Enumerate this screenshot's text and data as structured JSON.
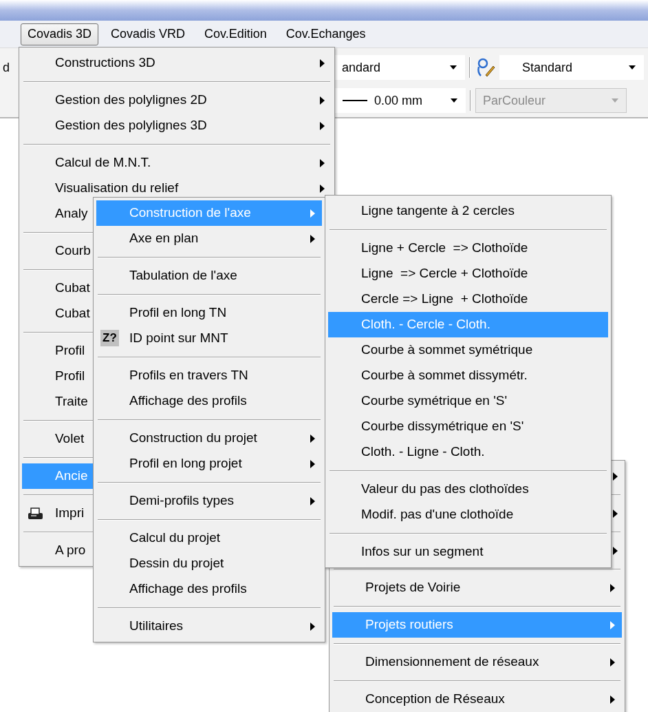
{
  "menubar": [
    {
      "label": "Covadis 3D",
      "selected": true
    },
    {
      "label": "Covadis VRD",
      "selected": false
    },
    {
      "label": "Cov.Edition",
      "selected": false
    },
    {
      "label": "Cov.Echanges",
      "selected": false
    }
  ],
  "toolbar": {
    "row_1": {
      "edge_text": "d",
      "combos": [
        {
          "value": "andard",
          "disabled": false
        },
        {
          "value": "Standard",
          "disabled": false
        }
      ]
    },
    "row_2": {
      "combos": [
        {
          "value": "0.00 mm",
          "disabled": false
        },
        {
          "value": "ParCouleur",
          "disabled": true
        }
      ]
    }
  },
  "menus": [
    {
      "items": [
        {
          "kind": "item",
          "label": "Constructions 3D",
          "submenu": true,
          "selected": false
        },
        {
          "kind": "separator"
        },
        {
          "kind": "item",
          "label": "Gestion des polylignes 2D",
          "submenu": true,
          "selected": false
        },
        {
          "kind": "item",
          "label": "Gestion des polylignes 3D",
          "submenu": true,
          "selected": false
        },
        {
          "kind": "separator"
        },
        {
          "kind": "item",
          "label": "Calcul de M.N.T.",
          "submenu": true,
          "selected": false
        },
        {
          "kind": "item",
          "label": "Visualisation du relief",
          "submenu": true,
          "selected": false
        },
        {
          "kind": "partial",
          "label": "Analy",
          "submenu": false,
          "selected": false
        },
        {
          "kind": "separator"
        },
        {
          "kind": "partial",
          "label": "Courb",
          "submenu": false,
          "selected": false
        },
        {
          "kind": "separator"
        },
        {
          "kind": "partial",
          "label": "Cubat",
          "submenu": false,
          "selected": false
        },
        {
          "kind": "partial",
          "label": "Cubat",
          "submenu": false,
          "selected": false
        },
        {
          "kind": "separator"
        },
        {
          "kind": "partial",
          "label": "Profil",
          "submenu": false,
          "selected": false
        },
        {
          "kind": "partial",
          "label": "Profil",
          "submenu": false,
          "selected": false
        },
        {
          "kind": "partial",
          "label": "Traite",
          "submenu": false,
          "selected": false
        },
        {
          "kind": "separator"
        },
        {
          "kind": "partial",
          "label": "Volet",
          "submenu": false,
          "selected": false
        },
        {
          "kind": "separator"
        },
        {
          "kind": "partial",
          "label": "Ancie",
          "submenu": false,
          "selected": true
        },
        {
          "kind": "separator"
        },
        {
          "kind": "printer",
          "label": "Impri",
          "submenu": false,
          "selected": false
        },
        {
          "kind": "separator"
        },
        {
          "kind": "partial",
          "label": "A pro",
          "submenu": false,
          "selected": false
        }
      ]
    },
    {
      "items": [
        {
          "kind": "item",
          "label": "Construction de l'axe",
          "submenu": true,
          "selected": true
        },
        {
          "kind": "item",
          "label": "Axe en plan",
          "submenu": true,
          "selected": false
        },
        {
          "kind": "separator"
        },
        {
          "kind": "item",
          "label": "Tabulation de l'axe",
          "submenu": false,
          "selected": false
        },
        {
          "kind": "separator"
        },
        {
          "kind": "item",
          "label": "Profil en long TN",
          "submenu": false,
          "selected": false
        },
        {
          "kind": "item",
          "label": "ID point sur MNT",
          "submenu": false,
          "selected": false,
          "badge": "Z?"
        },
        {
          "kind": "separator"
        },
        {
          "kind": "item",
          "label": "Profils en travers TN",
          "submenu": false,
          "selected": false
        },
        {
          "kind": "item",
          "label": "Affichage des profils",
          "submenu": false,
          "selected": false
        },
        {
          "kind": "separator"
        },
        {
          "kind": "item",
          "label": "Construction du projet",
          "submenu": true,
          "selected": false
        },
        {
          "kind": "item",
          "label": "Profil en long projet",
          "submenu": true,
          "selected": false
        },
        {
          "kind": "separator"
        },
        {
          "kind": "item",
          "label": "Demi-profils types",
          "submenu": true,
          "selected": false
        },
        {
          "kind": "separator"
        },
        {
          "kind": "item",
          "label": "Calcul du projet",
          "submenu": false,
          "selected": false
        },
        {
          "kind": "item",
          "label": "Dessin du projet",
          "submenu": false,
          "selected": false
        },
        {
          "kind": "item",
          "label": "Affichage des profils",
          "submenu": false,
          "selected": false
        },
        {
          "kind": "separator"
        },
        {
          "kind": "item",
          "label": "Utilitaires",
          "submenu": true,
          "selected": false
        }
      ]
    },
    {
      "items": [
        {
          "kind": "item",
          "label": "Ligne tangente à 2 cercles",
          "submenu": false,
          "selected": false
        },
        {
          "kind": "separator"
        },
        {
          "kind": "item",
          "label": "Ligne + Cercle  => Clothoïde",
          "submenu": false,
          "selected": false
        },
        {
          "kind": "item",
          "label": "Ligne  => Cercle + Clothoïde",
          "submenu": false,
          "selected": false
        },
        {
          "kind": "item",
          "label": "Cercle => Ligne  + Clothoïde",
          "submenu": false,
          "selected": false
        },
        {
          "kind": "item",
          "label": "Cloth. - Cercle - Cloth.",
          "submenu": false,
          "selected": true
        },
        {
          "kind": "item",
          "label": "Courbe à sommet symétrique",
          "submenu": false,
          "selected": false
        },
        {
          "kind": "item",
          "label": "Courbe à sommet dissymétr.",
          "submenu": false,
          "selected": false
        },
        {
          "kind": "item",
          "label": "Courbe symétrique en 'S'",
          "submenu": false,
          "selected": false
        },
        {
          "kind": "item",
          "label": "Courbe dissymétrique en 'S'",
          "submenu": false,
          "selected": false
        },
        {
          "kind": "item",
          "label": "Cloth. - Ligne - Cloth.",
          "submenu": false,
          "selected": false
        },
        {
          "kind": "separator"
        },
        {
          "kind": "item",
          "label": "Valeur du pas des clothoïdes",
          "submenu": false,
          "selected": false
        },
        {
          "kind": "item",
          "label": "Modif. pas d'une clothoïde",
          "submenu": false,
          "selected": false
        },
        {
          "kind": "separator"
        },
        {
          "kind": "item",
          "label": "Infos sur un segment",
          "submenu": false,
          "selected": false
        }
      ]
    },
    {
      "items": [
        {
          "kind": "covered",
          "submenu": true
        },
        {
          "kind": "separator"
        },
        {
          "kind": "covered",
          "submenu": true
        },
        {
          "kind": "separator"
        },
        {
          "kind": "covered",
          "submenu": true
        },
        {
          "kind": "separator"
        },
        {
          "kind": "item",
          "label": "Projets de Voirie",
          "submenu": true,
          "selected": false
        },
        {
          "kind": "separator"
        },
        {
          "kind": "item",
          "label": "Projets routiers",
          "submenu": true,
          "selected": true
        },
        {
          "kind": "separator"
        },
        {
          "kind": "item",
          "label": "Dimensionnement de réseaux",
          "submenu": true,
          "selected": false
        },
        {
          "kind": "separator"
        },
        {
          "kind": "item",
          "label": "Conception de Réseaux",
          "submenu": true,
          "selected": false
        }
      ]
    }
  ]
}
